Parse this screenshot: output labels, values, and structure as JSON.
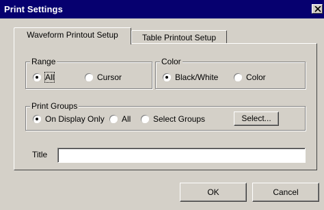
{
  "window": {
    "title": "Print Settings"
  },
  "tabs": [
    {
      "label": "Waveform Printout Setup"
    },
    {
      "label": "Table Printout Setup"
    }
  ],
  "range": {
    "label": "Range",
    "options": [
      {
        "label": "All",
        "checked": true
      },
      {
        "label": "Cursor",
        "checked": false
      }
    ]
  },
  "color": {
    "label": "Color",
    "options": [
      {
        "label": "Black/White",
        "checked": true
      },
      {
        "label": "Color",
        "checked": false
      }
    ]
  },
  "print_groups": {
    "label": "Print Groups",
    "options": [
      {
        "label": "On Display Only",
        "checked": true
      },
      {
        "label": "All",
        "checked": false
      },
      {
        "label": "Select Groups",
        "checked": false
      }
    ],
    "select_button": "Select..."
  },
  "title_field": {
    "label": "Title",
    "value": ""
  },
  "buttons": {
    "ok": "OK",
    "cancel": "Cancel"
  },
  "icons": {
    "close": "close-icon"
  },
  "colors": {
    "titlebar": "#06006f",
    "face": "#d4d0c8"
  }
}
